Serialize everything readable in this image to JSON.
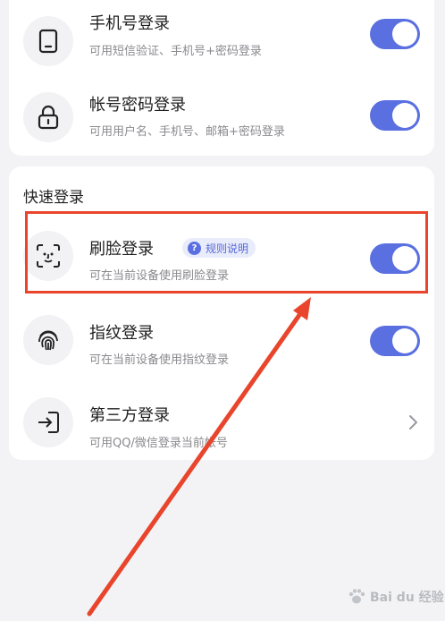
{
  "login_methods": {
    "phone": {
      "title": "手机号登录",
      "subtitle": "可用短信验证、手机号+密码登录",
      "icon": "phone-icon",
      "enabled": true
    },
    "account": {
      "title": "帐号密码登录",
      "subtitle": "可用用户名、手机号、邮箱+密码登录",
      "icon": "lock-icon",
      "enabled": true
    }
  },
  "quick_login": {
    "section_title": "快速登录",
    "face": {
      "title": "刷脸登录",
      "subtitle": "可在当前设备使用刷脸登录",
      "badge": "规则说明",
      "badge_icon_text": "?",
      "icon": "face-scan-icon",
      "enabled": true
    },
    "fingerprint": {
      "title": "指纹登录",
      "subtitle": "可在当前设备使用指纹登录",
      "icon": "fingerprint-icon",
      "enabled": true
    },
    "third_party": {
      "title": "第三方登录",
      "subtitle": "可用QQ/微信登录当前帐号",
      "icon": "login-enter-icon"
    }
  },
  "watermark": {
    "text": "Bai du 经验"
  },
  "colors": {
    "accent": "#5a6fe0",
    "annotation": "#e8452c"
  }
}
